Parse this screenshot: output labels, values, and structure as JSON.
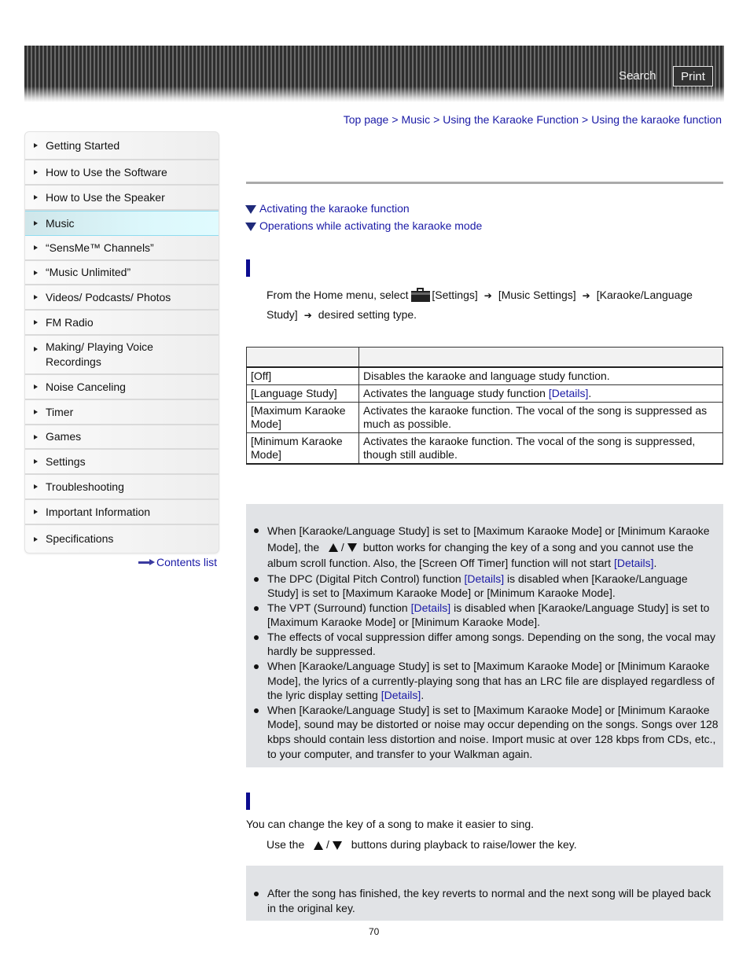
{
  "header": {
    "search_label": "Search",
    "print_label": "Print"
  },
  "sidebar": {
    "items": [
      {
        "label": "Getting Started",
        "active": false
      },
      {
        "label": "How to Use the Software",
        "active": false
      },
      {
        "label": "How to Use the Speaker",
        "active": false
      },
      {
        "label": "Music",
        "active": true
      },
      {
        "label": "“SensMe™ Channels”",
        "active": false
      },
      {
        "label": "“Music Unlimited”",
        "active": false
      },
      {
        "label": "Videos/ Podcasts/ Photos",
        "active": false
      },
      {
        "label": "FM Radio",
        "active": false
      },
      {
        "label": "Making/ Playing Voice Recordings",
        "active": false
      },
      {
        "label": "Noise Canceling",
        "active": false
      },
      {
        "label": "Timer",
        "active": false
      },
      {
        "label": "Games",
        "active": false
      },
      {
        "label": "Settings",
        "active": false
      },
      {
        "label": "Troubleshooting",
        "active": false
      },
      {
        "label": "Important Information",
        "active": false
      },
      {
        "label": "Specifications",
        "active": false
      }
    ],
    "contents_list_label": "Contents list"
  },
  "breadcrumb": {
    "items": [
      "Top page",
      "Music",
      "Using the Karaoke Function",
      "Using the karaoke function"
    ],
    "separator": ">"
  },
  "toc": {
    "links": [
      "Activating the karaoke function",
      "Operations while activating the karaoke mode"
    ]
  },
  "section1": {
    "step": {
      "prefix": "From the Home menu, select",
      "settings": "[Settings]",
      "music_settings": "[Music Settings]",
      "karaoke": "[Karaoke/Language",
      "karaoke_cont": "Study]",
      "suffix": "desired setting type."
    },
    "table": {
      "header": [
        "",
        ""
      ],
      "rows": [
        {
          "option": "[Off]",
          "description": "Disables the karaoke and language study function.",
          "link": ""
        },
        {
          "option": "[Language Study]",
          "description": "Activates the language study function ",
          "link": "[Details]",
          "tail": "."
        },
        {
          "option": "[Maximum Karaoke Mode]",
          "description": "Activates the karaoke function. The vocal of the song is suppressed as much as possible.",
          "link": ""
        },
        {
          "option": "[Minimum Karaoke Mode]",
          "description": "Activates the karaoke function. The vocal of the song is suppressed, though still audible.",
          "link": ""
        }
      ]
    },
    "notes": [
      {
        "a": "When [Karaoke/Language Study] is set to [Maximum Karaoke Mode] or [Minimum Karaoke Mode], the",
        "b": "button works for changing the key of a song and you cannot use the album scroll function. Also, the [Screen Off Timer] function will not start ",
        "link": "[Details]",
        "tail": "."
      },
      {
        "a": "The DPC (Digital Pitch Control) function ",
        "link": "[Details]",
        "tail": " is disabled when [Karaoke/Language Study] is set to [Maximum Karaoke Mode] or [Minimum Karaoke Mode]."
      },
      {
        "a": "The VPT (Surround) function ",
        "link": "[Details]",
        "tail": " is disabled when [Karaoke/Language Study] is set to [Maximum Karaoke Mode] or [Minimum Karaoke Mode]."
      },
      {
        "a": "The effects of vocal suppression differ among songs. Depending on the song, the vocal may hardly be suppressed."
      },
      {
        "a": "When [Karaoke/Language Study] is set to [Maximum Karaoke Mode] or [Minimum Karaoke Mode], the lyrics of a currently-playing song that has an LRC file are displayed regardless of the lyric display setting ",
        "link": "[Details]",
        "tail": "."
      },
      {
        "a": "When [Karaoke/Language Study] is set to [Maximum Karaoke Mode] or [Minimum Karaoke Mode], sound may be distorted or noise may occur depending on the songs. Songs over 128 kbps should contain less distortion and noise. Import music at over 128 kbps from CDs, etc., to your computer, and transfer to your Walkman again."
      }
    ]
  },
  "section2": {
    "intro": "You can change the key of a song to make it easier to sing.",
    "step_prefix": "Use the",
    "step_suffix": "buttons during playback to raise/lower the key.",
    "slash": "/",
    "notes": [
      {
        "a": "After the song has finished, the key reverts to normal and the next song will be played back in the original key."
      }
    ]
  },
  "page_number": "70"
}
